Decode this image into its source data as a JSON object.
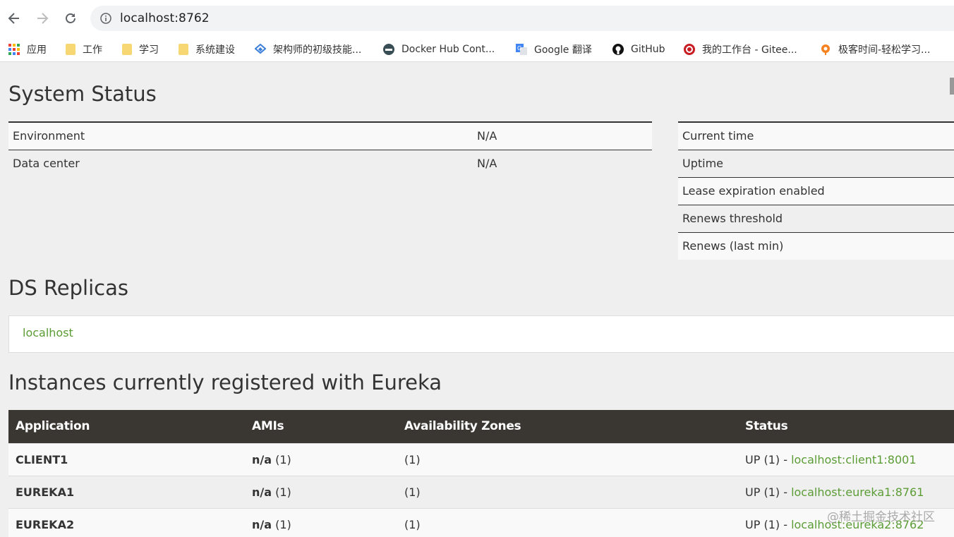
{
  "browser": {
    "url": "localhost:8762",
    "bookmarks": [
      {
        "label": "应用",
        "icon": "apps-grid-icon"
      },
      {
        "label": "工作",
        "icon": "folder-icon"
      },
      {
        "label": "学习",
        "icon": "folder-icon"
      },
      {
        "label": "系统建设",
        "icon": "folder-icon"
      },
      {
        "label": "架构师的初级技能...",
        "icon": "blue-diamond-icon"
      },
      {
        "label": "Docker Hub Cont...",
        "icon": "docker-icon"
      },
      {
        "label": "Google 翻译",
        "icon": "google-translate-icon"
      },
      {
        "label": "GitHub",
        "icon": "github-icon"
      },
      {
        "label": "我的工作台 - Gitee...",
        "icon": "gitee-icon"
      },
      {
        "label": "极客时间-轻松学习...",
        "icon": "geektime-icon"
      }
    ]
  },
  "system_status": {
    "title": "System Status",
    "left_rows": [
      {
        "label": "Environment",
        "value": "N/A"
      },
      {
        "label": "Data center",
        "value": "N/A"
      }
    ],
    "right_rows": [
      {
        "label": "Current time"
      },
      {
        "label": "Uptime"
      },
      {
        "label": "Lease expiration enabled"
      },
      {
        "label": "Renews threshold"
      },
      {
        "label": "Renews (last min)"
      }
    ]
  },
  "replicas": {
    "title": "DS Replicas",
    "link": "localhost"
  },
  "instances": {
    "title": "Instances currently registered with Eureka",
    "headers": [
      "Application",
      "AMIs",
      "Availability Zones",
      "Status"
    ],
    "rows": [
      {
        "app": "CLIENT1",
        "amis_na": "n/a",
        "amis_count": " (1)",
        "zones": "(1)",
        "status_prefix": "UP (1) - ",
        "status_link": "localhost:client1:8001"
      },
      {
        "app": "EUREKA1",
        "amis_na": "n/a",
        "amis_count": " (1)",
        "zones": "(1)",
        "status_prefix": "UP (1) - ",
        "status_link": "localhost:eureka1:8761"
      },
      {
        "app": "EUREKA2",
        "amis_na": "n/a",
        "amis_count": " (1)",
        "zones": "(1)",
        "status_prefix": "UP (1) - ",
        "status_link": "localhost:eureka2:8762"
      }
    ]
  },
  "watermark": "@稀土掘金技术社区",
  "colors": {
    "link": "#5b9c35",
    "header_bg": "#3a3631"
  }
}
